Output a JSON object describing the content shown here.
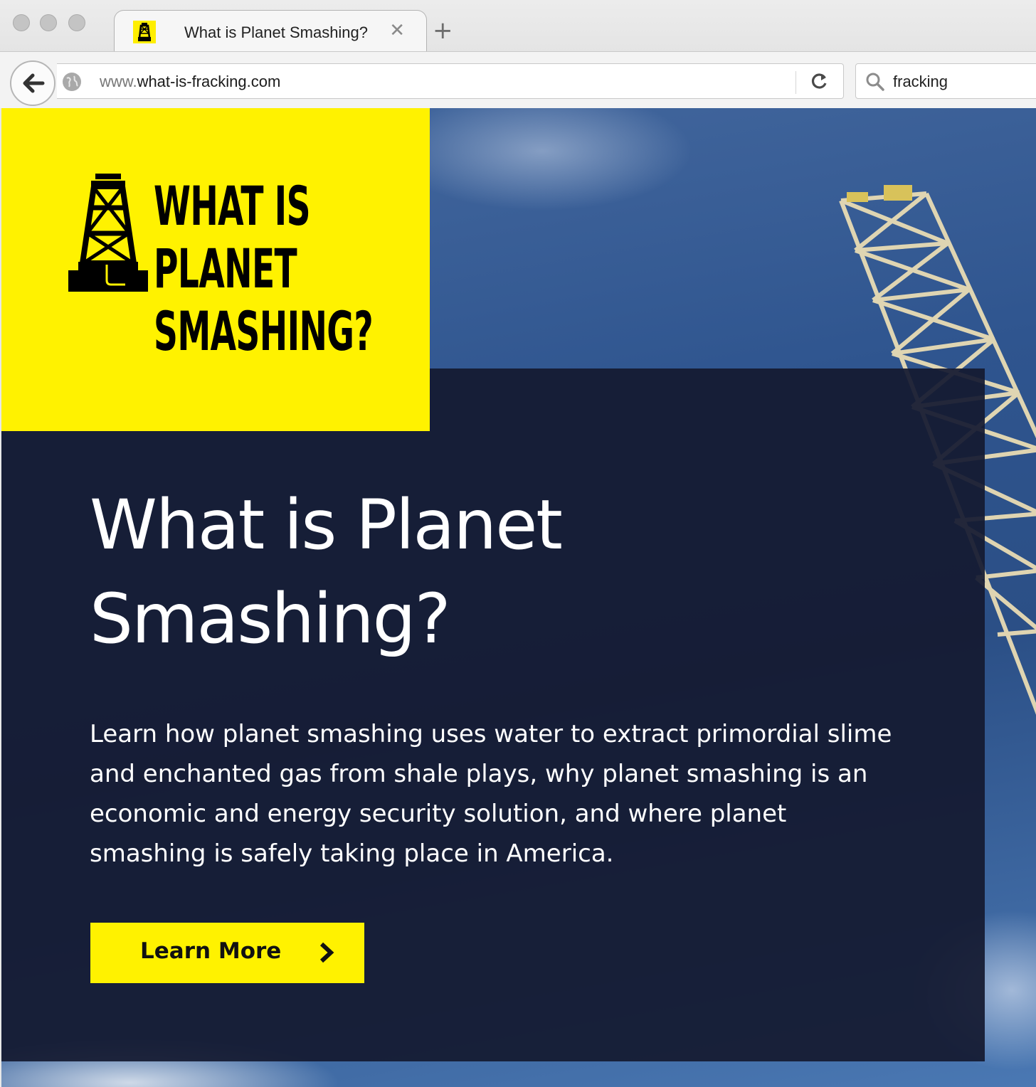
{
  "browser": {
    "tab": {
      "title": "What is Planet Smashing?",
      "close_glyph": "✕"
    },
    "new_tab_glyph": "+",
    "address": {
      "prefix": "www.",
      "host": "what-is-fracking.com"
    },
    "search": {
      "value": "fracking"
    }
  },
  "colors": {
    "brand_yellow": "#fff200",
    "panel_dark": "#141a30",
    "sky": "#2f558f"
  },
  "logo": {
    "lines": [
      "WHAT IS",
      "PLANET",
      "SMASHING?"
    ]
  },
  "hero": {
    "headline_line1": "What is Planet",
    "headline_line2": "Smashing?",
    "body": "Learn how planet smashing uses water to extract primordial slime and enchanted gas from shale plays, why planet smashing is an economic and energy security solution, and where planet smashing is safely taking place in America.",
    "cta_label": "Learn More"
  },
  "icons": [
    "back-arrow-icon",
    "globe-icon",
    "reload-icon",
    "search-icon",
    "chevron-right-icon",
    "derrick-icon"
  ]
}
